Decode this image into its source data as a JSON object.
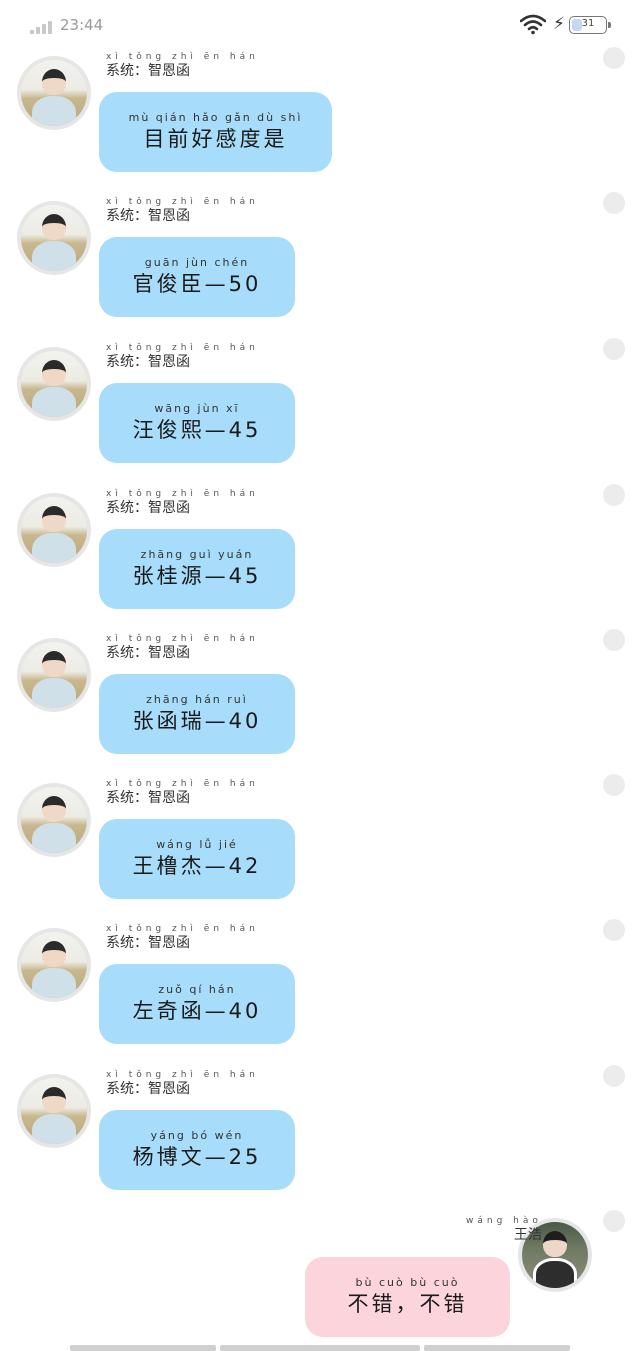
{
  "status_bar": {
    "time": "23:44",
    "battery": "31",
    "battery_level": 0.31
  },
  "messages": [
    {
      "sender": "系统：智恩函",
      "sender_pinyin": "xì tǒng   zhì ēn hán",
      "text_pinyin": "mù qián hǎo gǎn dù shì",
      "text": "目前好感度是"
    },
    {
      "sender": "系统：智恩函",
      "sender_pinyin": "xì tǒng   zhì ēn hán",
      "text_pinyin": "guān jùn chén",
      "text": "官俊臣—50"
    },
    {
      "sender": "系统：智恩函",
      "sender_pinyin": "xì tǒng   zhì ēn hán",
      "text_pinyin": "wāng jùn xī",
      "text": "汪俊熙—45"
    },
    {
      "sender": "系统：智恩函",
      "sender_pinyin": "xì tǒng   zhì ēn hán",
      "text_pinyin": "zhāng guì yuán",
      "text": "张桂源—45"
    },
    {
      "sender": "系统：智恩函",
      "sender_pinyin": "xì tǒng   zhì ēn hán",
      "text_pinyin": "zhāng hán ruì",
      "text": "张函瑞—40"
    },
    {
      "sender": "系统：智恩函",
      "sender_pinyin": "xì tǒng   zhì ēn hán",
      "text_pinyin": "wáng lǚ jié",
      "text": "王橹杰—42"
    },
    {
      "sender": "系统：智恩函",
      "sender_pinyin": "xì tǒng   zhì ēn hán",
      "text_pinyin": "zuǒ qí hán",
      "text": "左奇函—40"
    },
    {
      "sender": "系统：智恩函",
      "sender_pinyin": "xì tǒng   zhì ēn hán",
      "text_pinyin": "yáng bó wén",
      "text": "杨博文—25"
    }
  ],
  "reply": {
    "sender": "王浩",
    "sender_pinyin": "wáng hào",
    "text_pinyin": "bù cuò   bù cuò",
    "text": "不错，不错"
  },
  "colors": {
    "bubble_left": "#a7dcfa",
    "bubble_right": "#fbd4dc"
  }
}
